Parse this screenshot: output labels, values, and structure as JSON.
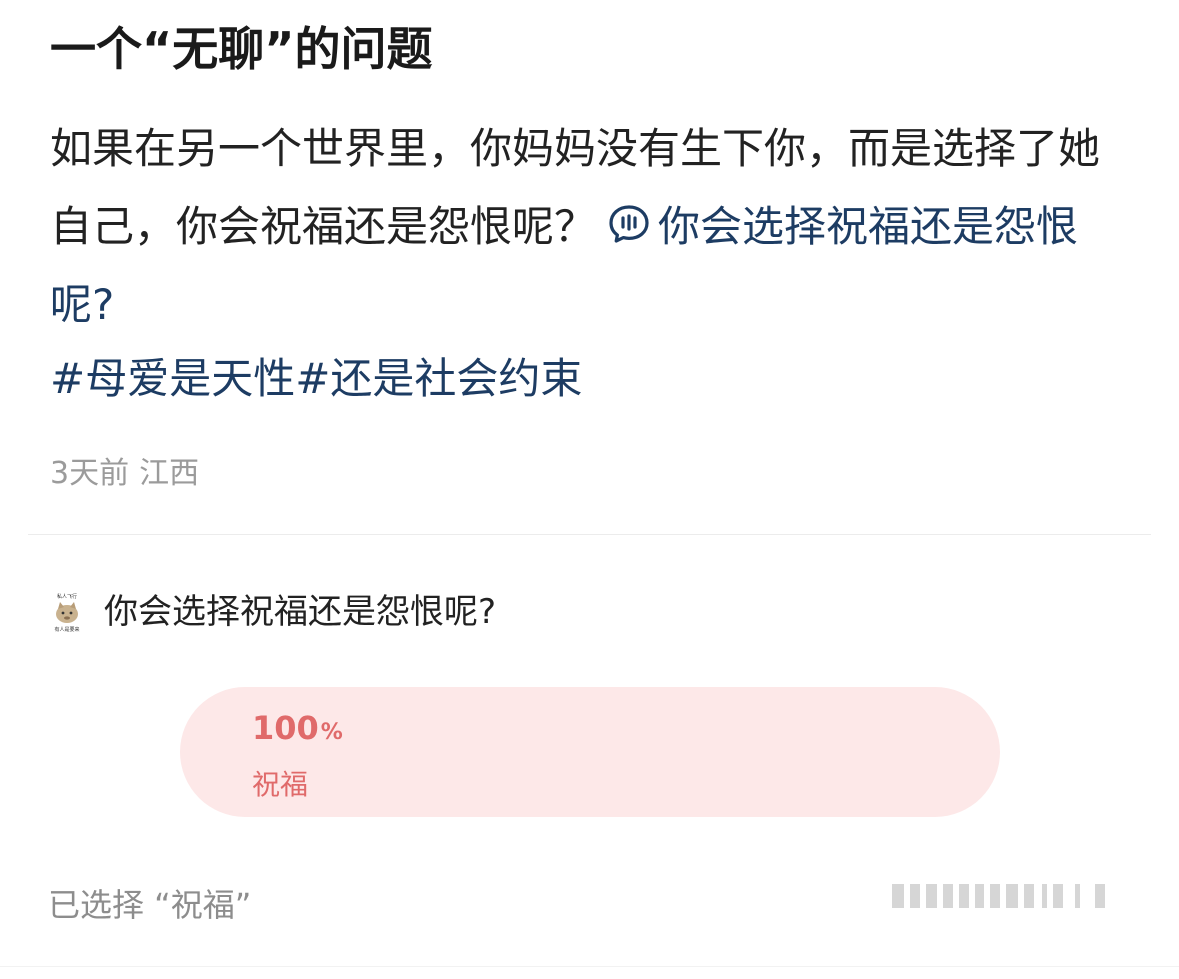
{
  "post": {
    "title": "一个“无聊”的问题",
    "body": "如果在另一个世界里，你妈妈没有生下你，而是选择了她自己，你会祝福还是怨恨呢？",
    "topic_link": "你会选择祝福还是怨恨呢?",
    "hashtags": [
      "#母爱是天性#",
      "还是社会约束"
    ],
    "time": "3天前",
    "location": "江西"
  },
  "poll": {
    "question": "你会选择祝福还是怨恨呢?",
    "avatar_caption": [
      "私人飞行",
      "有人是要来"
    ],
    "options": [
      {
        "percent": "100",
        "unit": "%",
        "label": "祝福",
        "share": 1.0
      }
    ],
    "selected_text": "已选择 “祝福”"
  },
  "colors": {
    "link": "#1d3c63",
    "accent": "#e06a6a",
    "option_bg": "#fde8e8",
    "meta": "#9b9b9b"
  },
  "icons": {
    "topic": "chat-bubble-icon",
    "avatar": "cat-meme-avatar"
  }
}
